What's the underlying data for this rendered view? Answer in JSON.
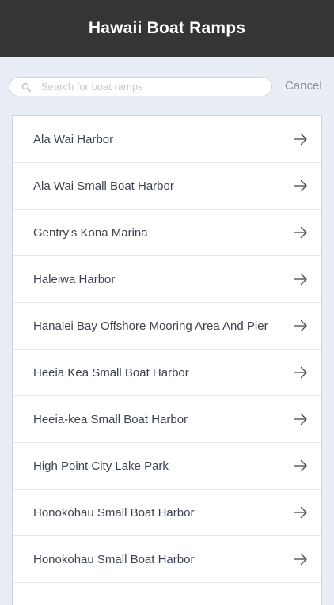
{
  "header": {
    "title": "Hawaii Boat Ramps"
  },
  "search": {
    "placeholder": "Search for boat ramps",
    "value": "",
    "icon": "search-icon",
    "cancel_label": "Cancel"
  },
  "list": {
    "items": [
      {
        "label": "Ala Wai Harbor",
        "icon": "arrow-right-icon"
      },
      {
        "label": "Ala Wai Small Boat Harbor",
        "icon": "arrow-right-icon"
      },
      {
        "label": "Gentry's Kona Marina",
        "icon": "arrow-right-icon"
      },
      {
        "label": "Haleiwa Harbor",
        "icon": "arrow-right-icon"
      },
      {
        "label": "Hanalei Bay Offshore Mooring Area And Pier",
        "icon": "arrow-right-icon"
      },
      {
        "label": "Heeia Kea Small Boat Harbor",
        "icon": "arrow-right-icon"
      },
      {
        "label": "Heeia-kea Small Boat Harbor",
        "icon": "arrow-right-icon"
      },
      {
        "label": "High Point City Lake Park",
        "icon": "arrow-right-icon"
      },
      {
        "label": "Honokohau Small Boat Harbor",
        "icon": "arrow-right-icon"
      },
      {
        "label": "Honokohau Small Boat Harbor",
        "icon": "arrow-right-icon"
      },
      {
        "label": "",
        "icon": "arrow-right-icon"
      }
    ]
  },
  "colors": {
    "header_bg": "#353535",
    "page_bg": "#e9edf5",
    "text": "#3c4350",
    "muted": "#8b8f96"
  }
}
